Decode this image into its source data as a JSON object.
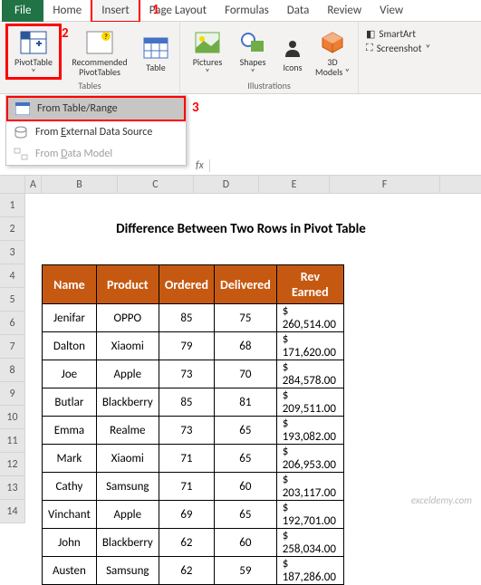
{
  "tabs": {
    "file": "File",
    "home": "Home",
    "insert": "Insert",
    "pagelayout": "Page Layout",
    "formulas": "Formulas",
    "data": "Data",
    "review": "Review",
    "view": "View"
  },
  "annotations": {
    "a1": "1",
    "a2": "2",
    "a3": "3"
  },
  "ribbon": {
    "pivottable": "PivotTable",
    "recommended": "Recommended\nPivotTables",
    "table": "Table",
    "tables_group": "Tables",
    "pictures": "Pictures",
    "shapes": "Shapes",
    "icons": "Icons",
    "models": "3D\nModels",
    "ill_group": "Illustrations",
    "smartart": "SmartArt",
    "screenshot": "Screenshot"
  },
  "menu": {
    "from_table": "From Table/Range",
    "from_ext": "From External Data Source",
    "from_dm": "From Data Model"
  },
  "fx": "fx",
  "cols": {
    "A": "A",
    "B": "B",
    "C": "C",
    "D": "D",
    "E": "E",
    "F": "F"
  },
  "rows": [
    "1",
    "2",
    "3",
    "4",
    "5",
    "6",
    "7",
    "8",
    "9",
    "10",
    "11",
    "12",
    "13",
    "14"
  ],
  "title": "Difference Between Two Rows in Pivot Table",
  "headers": {
    "name": "Name",
    "product": "Product",
    "ordered": "Ordered",
    "delivered": "Delivered",
    "rev": "Rev Earned"
  },
  "data": [
    {
      "name": "Jenifar",
      "product": "OPPO",
      "ordered": "85",
      "delivered": "75",
      "rev": "260,514.00"
    },
    {
      "name": "Dalton",
      "product": "Xiaomi",
      "ordered": "79",
      "delivered": "68",
      "rev": "171,620.00"
    },
    {
      "name": "Joe",
      "product": "Apple",
      "ordered": "73",
      "delivered": "70",
      "rev": "284,578.00"
    },
    {
      "name": "Butlar",
      "product": "Blackberry",
      "ordered": "85",
      "delivered": "81",
      "rev": "209,511.00"
    },
    {
      "name": "Emma",
      "product": "Realme",
      "ordered": "73",
      "delivered": "65",
      "rev": "193,082.00"
    },
    {
      "name": "Mark",
      "product": "Xiaomi",
      "ordered": "71",
      "delivered": "65",
      "rev": "206,953.00"
    },
    {
      "name": "Cathy",
      "product": "Samsung",
      "ordered": "71",
      "delivered": "60",
      "rev": "203,117.00"
    },
    {
      "name": "Vinchant",
      "product": "Apple",
      "ordered": "69",
      "delivered": "65",
      "rev": "192,701.00"
    },
    {
      "name": "John",
      "product": "Blackberry",
      "ordered": "62",
      "delivered": "60",
      "rev": "258,034.00"
    },
    {
      "name": "Austen",
      "product": "Samsung",
      "ordered": "62",
      "delivered": "59",
      "rev": "187,286.00"
    }
  ],
  "dollar": "$",
  "watermark": "exceldemy.com"
}
